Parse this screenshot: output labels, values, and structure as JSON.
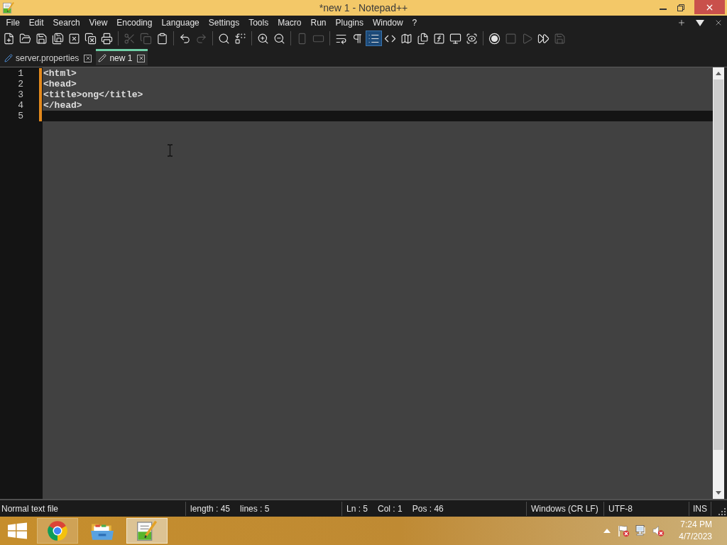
{
  "window": {
    "title": "*new 1 - Notepad++"
  },
  "menu": [
    "File",
    "Edit",
    "Search",
    "View",
    "Encoding",
    "Language",
    "Settings",
    "Tools",
    "Macro",
    "Run",
    "Plugins",
    "Window",
    "?"
  ],
  "toolbar": {
    "groups": [
      {
        "items": [
          {
            "disabled": false,
            "on": false
          },
          {
            "disabled": false,
            "on": false
          },
          {
            "disabled": false,
            "on": false
          },
          {
            "disabled": false,
            "on": false
          },
          {
            "disabled": false,
            "on": false
          },
          {
            "disabled": false,
            "on": false
          },
          {
            "disabled": false,
            "on": false
          }
        ]
      },
      {
        "items": [
          {
            "disabled": true,
            "on": false
          },
          {
            "disabled": true,
            "on": false
          },
          {
            "disabled": false,
            "on": false
          }
        ]
      },
      {
        "items": [
          {
            "disabled": false,
            "on": false
          },
          {
            "disabled": true,
            "on": false
          }
        ]
      },
      {
        "items": [
          {
            "disabled": false,
            "on": false
          },
          {
            "disabled": false,
            "on": false
          }
        ]
      },
      {
        "items": [
          {
            "disabled": false,
            "on": false
          },
          {
            "disabled": false,
            "on": false
          }
        ]
      },
      {
        "items": [
          {
            "disabled": true,
            "on": false
          },
          {
            "disabled": true,
            "on": false
          }
        ]
      },
      {
        "items": [
          {
            "disabled": false,
            "on": false
          },
          {
            "disabled": false,
            "on": false
          },
          {
            "disabled": false,
            "on": true
          },
          {
            "disabled": false,
            "on": false
          },
          {
            "disabled": false,
            "on": false
          },
          {
            "disabled": false,
            "on": false
          },
          {
            "disabled": false,
            "on": false
          },
          {
            "disabled": false,
            "on": false
          },
          {
            "disabled": false,
            "on": false
          }
        ]
      },
      {
        "items": [
          {
            "disabled": false,
            "on": false
          },
          {
            "disabled": true,
            "on": false
          },
          {
            "disabled": true,
            "on": false
          },
          {
            "disabled": false,
            "on": false
          },
          {
            "disabled": true,
            "on": false
          }
        ]
      }
    ]
  },
  "tabs": [
    {
      "label": "server.properties",
      "selected": false
    },
    {
      "label": "new 1",
      "selected": true
    }
  ],
  "editor": {
    "lines": [
      {
        "number": "1",
        "text": "<html>",
        "changed": true,
        "current": false
      },
      {
        "number": "2",
        "text": "<head>",
        "changed": true,
        "current": false
      },
      {
        "number": "3",
        "text": "<title>ong</title>",
        "changed": true,
        "current": false
      },
      {
        "number": "4",
        "text": "</head>",
        "changed": true,
        "current": false
      },
      {
        "number": "5",
        "changed": true,
        "current": true
      }
    ]
  },
  "status_bar": {
    "sections": [
      {
        "items": [
          "Normal text file"
        ]
      },
      {
        "items": [
          "length : 45",
          "lines : 5"
        ]
      },
      {
        "items": [
          "Ln : 5",
          "Col : 1",
          "Pos : 46"
        ]
      },
      {
        "items": [
          "Windows (CR LF)"
        ]
      },
      {
        "items": [
          "UTF-8"
        ]
      },
      {
        "items": [
          "INS"
        ]
      }
    ]
  },
  "taskbar": {
    "apps": [
      {
        "running": true,
        "selected": false
      },
      {
        "running": false,
        "selected": false
      },
      {
        "running": true,
        "selected": true
      }
    ],
    "clock": {
      "time": "7:24 PM",
      "date": "4/7/2023"
    }
  }
}
